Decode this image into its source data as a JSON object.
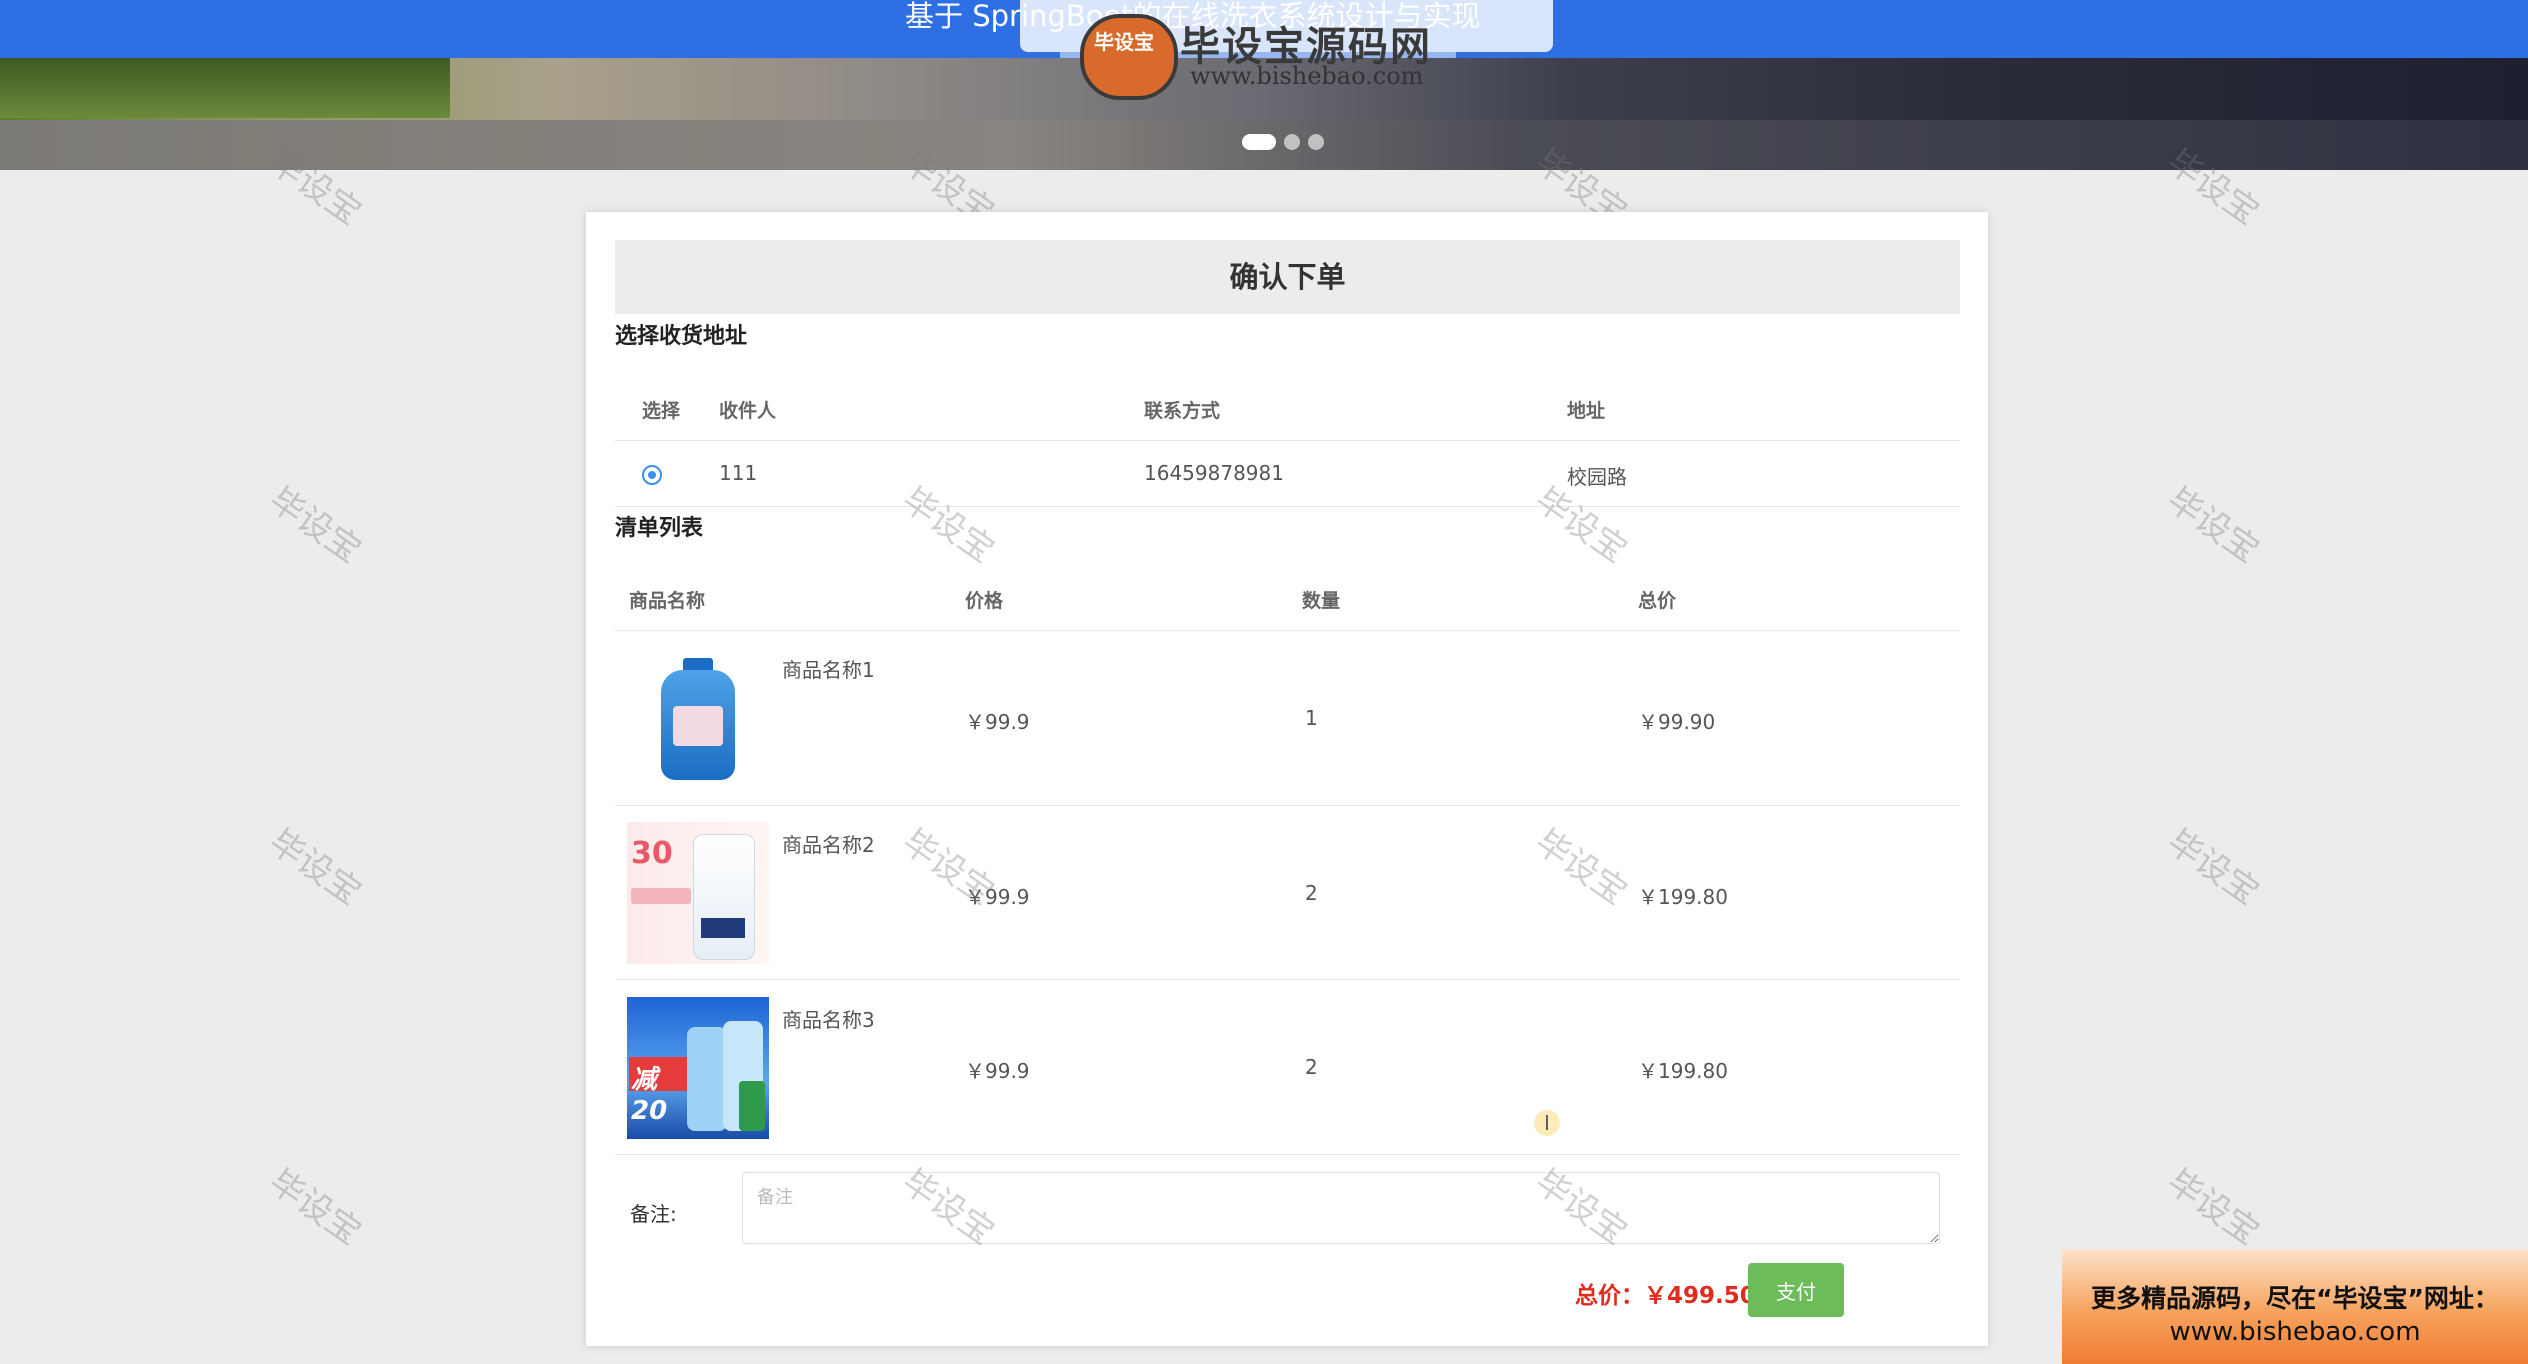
{
  "header": {
    "title": "基于 SpringBoot的在线洗衣系统设计与实现",
    "logo_badge": "毕设宝",
    "logo_text": "毕设宝源码网",
    "logo_url": "www.bishebao.com"
  },
  "carousel": {
    "slide_count": 3,
    "active_index": 0
  },
  "watermark": "毕设宝",
  "order": {
    "heading": "确认下单",
    "address_section": "选择收货地址",
    "address_columns": [
      "选择",
      "收件人",
      "联系方式",
      "地址"
    ],
    "addresses": [
      {
        "recipient": "111",
        "phone": "16459878981",
        "address": "校园路",
        "selected": true
      }
    ],
    "items_section": "清单列表",
    "item_columns": [
      "商品名称",
      "价格",
      "数量",
      "总价"
    ],
    "items": [
      {
        "name": "商品名称1",
        "price": "￥99.9",
        "qty": "1",
        "subtotal": "￥99.90"
      },
      {
        "name": "商品名称2",
        "price": "￥99.9",
        "qty": "2",
        "subtotal": "￥199.80"
      },
      {
        "name": "商品名称3",
        "price": "￥99.9",
        "qty": "2",
        "subtotal": "￥199.80"
      }
    ],
    "remark_label": "备注:",
    "remark_placeholder": "备注",
    "total_label": "总价：￥499.50",
    "pay_label": "支付"
  },
  "ad": {
    "line1": "更多精品源码，尽在“毕设宝”网址：",
    "line2": "www.bishebao.com"
  },
  "colors": {
    "topbar": "#2f6fe4",
    "pay_button": "#6cbd5a",
    "total": "#e22b1f",
    "radio": "#3d8ef0"
  }
}
